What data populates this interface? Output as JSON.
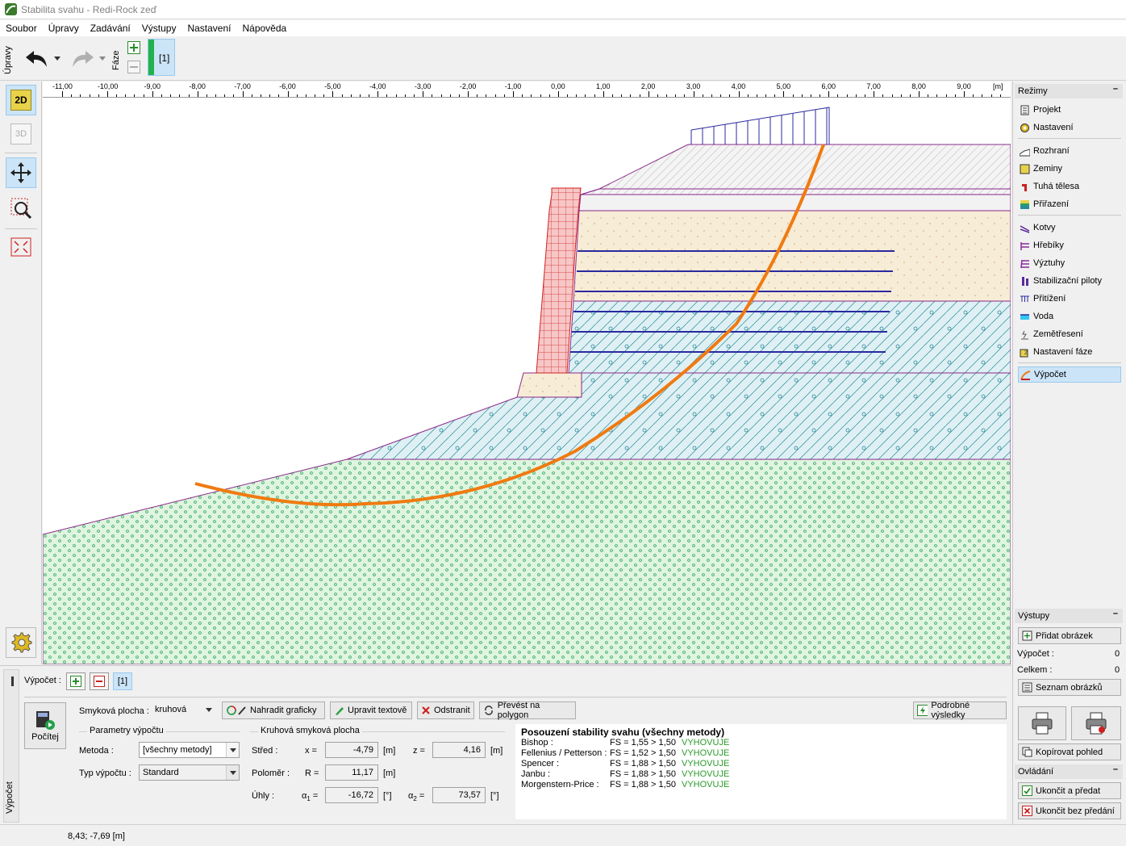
{
  "window": {
    "title": "Stabilita svahu - Redi-Rock zeď"
  },
  "menu": [
    "Soubor",
    "Úpravy",
    "Zadávání",
    "Výstupy",
    "Nastavení",
    "Nápověda"
  ],
  "toolbar": {
    "upravy_tab": "Úpravy",
    "faze_label": "Fáze",
    "stage_label": "[1]"
  },
  "left_tools": {
    "btn_2d": "2D",
    "btn_3d": "3D"
  },
  "ruler": {
    "ticks": [
      "-11,00",
      "-10,00",
      "-9,00",
      "-8,00",
      "-7,00",
      "-6,00",
      "-5,00",
      "-4,00",
      "-3,00",
      "-2,00",
      "-1,00",
      "0,00",
      "1,00",
      "2,00",
      "3,00",
      "4,00",
      "5,00",
      "6,00",
      "7,00",
      "8,00",
      "9,00"
    ],
    "unit": "[m]"
  },
  "modes": {
    "header": "Režimy",
    "items": [
      "Projekt",
      "Nastavení",
      "Rozhraní",
      "Zeminy",
      "Tuhá tělesa",
      "Přiřazení",
      "Kotvy",
      "Hřebíky",
      "Výztuhy",
      "Stabilizační piloty",
      "Přitížení",
      "Voda",
      "Zemětřesení",
      "Nastavení fáze",
      "Výpočet"
    ]
  },
  "outputs": {
    "header": "Výstupy",
    "add_image": "Přidat obrázek",
    "vypocet_label": "Výpočet :",
    "vypocet_value": "0",
    "celkem_label": "Celkem :",
    "celkem_value": "0",
    "list_images": "Seznam obrázků",
    "copy_view": "Kopírovat pohled"
  },
  "control": {
    "header": "Ovládání",
    "finish": "Ukončit a předat",
    "finish_no": "Ukončit bez předání"
  },
  "calc": {
    "side_tab": "Výpočet",
    "label": "Výpočet :",
    "stage": "[1]",
    "run": "Počítej",
    "slip_label": "Smyková plocha :",
    "slip_value": "kruhová",
    "btn_replace": "Nahradit graficky",
    "btn_edit": "Upravit textově",
    "btn_remove": "Odstranit",
    "btn_polygon": "Převést na polygon",
    "btn_detail": "Podrobné výsledky",
    "params_group": "Parametry výpočtu",
    "method_label": "Metoda :",
    "method_value": "[všechny metody]",
    "type_label": "Typ výpočtu :",
    "type_value": "Standard",
    "circle_group": "Kruhová smyková plocha",
    "center_label": "Střed :",
    "x_label": "x =",
    "x_value": "-4,79",
    "z_label": "z =",
    "z_value": "4,16",
    "unit_m": "[m]",
    "radius_label": "Poloměr :",
    "r_label": "R =",
    "r_value": "11,17",
    "angles_label": "Úhly :",
    "a1_value": "-16,72",
    "a2_value": "73,57",
    "unit_deg": "[°]"
  },
  "results": {
    "title": "Posouzení stability svahu (všechny metody)",
    "rows": [
      {
        "method": "Bishop :",
        "fs": "FS = 1,55 > 1,50",
        "status": "VYHOVUJE"
      },
      {
        "method": "Fellenius / Petterson :",
        "fs": "FS = 1,52 > 1,50",
        "status": "VYHOVUJE"
      },
      {
        "method": "Spencer :",
        "fs": "FS = 1,88 > 1,50",
        "status": "VYHOVUJE"
      },
      {
        "method": "Janbu :",
        "fs": "FS = 1,88 > 1,50",
        "status": "VYHOVUJE"
      },
      {
        "method": "Morgenstern-Price :",
        "fs": "FS = 1,88 > 1,50",
        "status": "VYHOVUJE"
      }
    ]
  },
  "status": {
    "coords": "8,43; -7,69 [m]"
  }
}
